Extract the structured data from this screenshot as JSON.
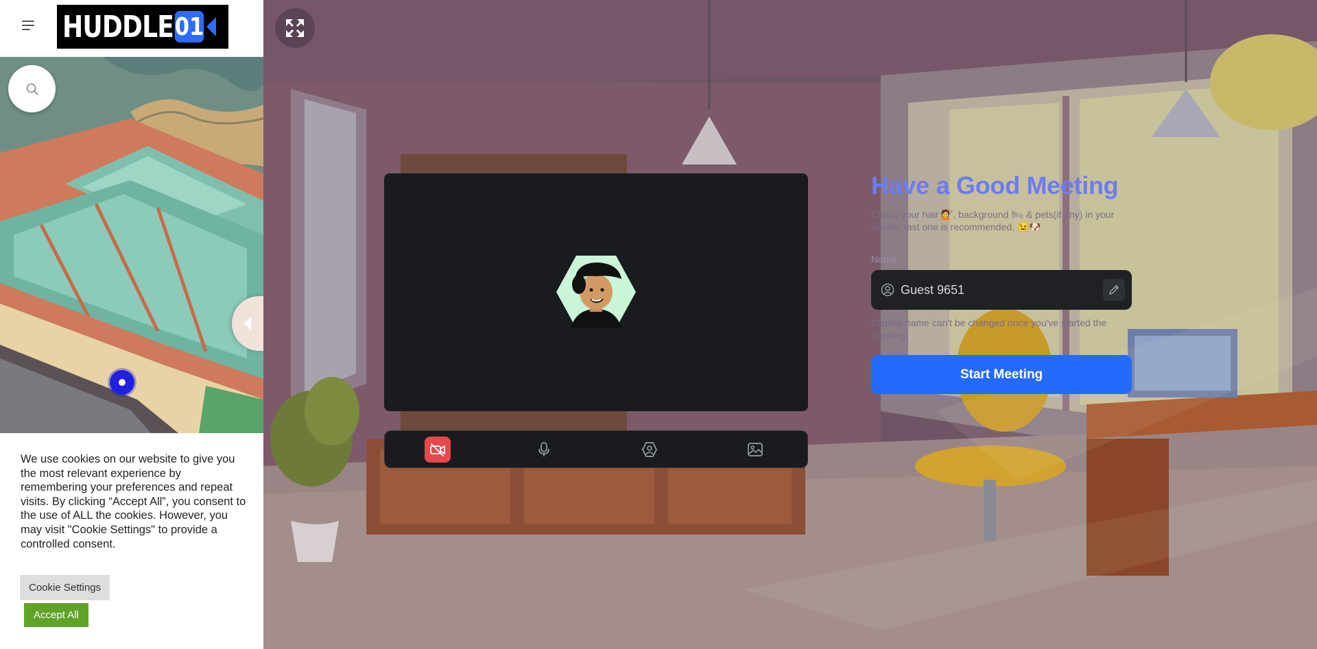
{
  "header": {
    "logo_text": "HUDDLE",
    "logo_badge": "01",
    "menu_icon": "hamburger-menu-icon"
  },
  "map": {
    "search_icon": "search-icon",
    "collapse_icon": "chevron-left-icon"
  },
  "cookie_banner": {
    "text": "We use cookies on our website to give you the most relevant experience by remembering your preferences and repeat visits. By clicking “Accept All”, you consent to the use of ALL the cookies. However, you may visit \"Cookie Settings\" to provide a controlled consent.",
    "settings_label": "Cookie Settings",
    "accept_label": "Accept All",
    "accept_color": "#61a229"
  },
  "toolbar": {
    "expand_icon": "fullscreen-icon"
  },
  "controls": {
    "camera_icon": "camera-off-icon",
    "mic_icon": "microphone-icon",
    "effects_icon": "effects-icon",
    "background_icon": "background-image-icon",
    "camera_off_color": "#e5484d"
  },
  "join_panel": {
    "title": "Have a Good Meeting",
    "subtitle": "Check your hair 💇, background 🛏 & pets(if any) in your vicinity, last one is recommended. 😉🐶",
    "name_label": "Name",
    "name_value": "Guest 9651",
    "name_hint": "Display name can't be changed once you've started the meeting.",
    "start_label": "Start Meeting",
    "title_color": "#6d7cf2",
    "accent": "#246bfd"
  }
}
